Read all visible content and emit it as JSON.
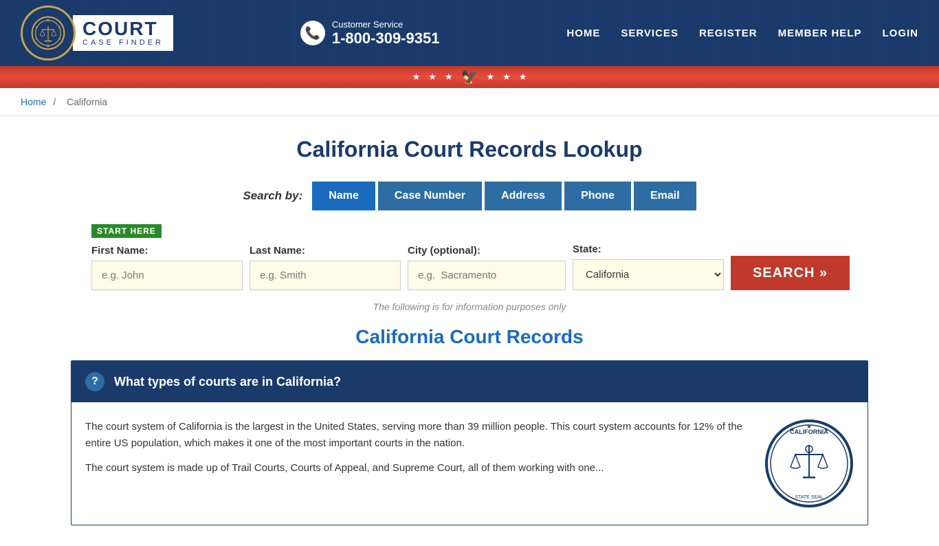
{
  "header": {
    "logo_court": "COURT",
    "logo_sub": "CASE FINDER",
    "customer_service_label": "Customer Service",
    "phone": "1-800-309-9351",
    "nav": [
      "HOME",
      "SERVICES",
      "REGISTER",
      "MEMBER HELP",
      "LOGIN"
    ]
  },
  "breadcrumb": {
    "home": "Home",
    "separator": "/",
    "current": "California"
  },
  "page_title": "California Court Records Lookup",
  "search": {
    "by_label": "Search by:",
    "tabs": [
      "Name",
      "Case Number",
      "Address",
      "Phone",
      "Email"
    ],
    "active_tab": "Name",
    "start_here": "START HERE",
    "fields": {
      "first_name_label": "First Name:",
      "first_name_placeholder": "e.g. John",
      "last_name_label": "Last Name:",
      "last_name_placeholder": "e.g. Smith",
      "city_label": "City (optional):",
      "city_placeholder": "e.g.  Sacramento",
      "state_label": "State:",
      "state_value": "California"
    },
    "search_button": "SEARCH »",
    "info_note": "The following is for information purposes only"
  },
  "records_title": "California Court Records",
  "accordion": {
    "question": "What types of courts are in California?",
    "para1": "The court system of California is the largest in the United States, serving more than 39 million people. This court system accounts for 12% of the entire US population, which makes it one of the most important courts in the nation.",
    "para2": "The court system is made up of Trail Courts, Courts of Appeal, and Supreme Court, all of them working with one..."
  }
}
